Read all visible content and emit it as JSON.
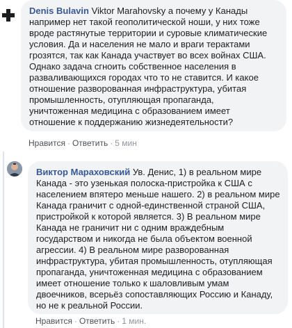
{
  "comment1": {
    "author": "Denis Bulavin",
    "mention": "Viktor Marahovsky",
    "lines": [
      "а почему у Канады",
      "например нет такой геополитической ноши, у них тоже",
      "вроде растянутые территории и суровые климатические",
      "условия. Да и населения не мало и враги терактами",
      "грозятся, так как Канада участвует во всех войнах США.",
      "Однако задача сгноить собственное населения в",
      "разваливающихся городах что то не ставится. И какое",
      "отношение разворованная инфраструктура, убитая",
      "промышленность, отупляющая пропаганда,",
      "уничтоженная медицина с образованием имеет",
      "отношение к поддержанию жизнедеятельности?"
    ],
    "like_label": "Нравится",
    "reply_label": "Ответить",
    "time": "5 мин",
    "separator": "·"
  },
  "comment2": {
    "author": "Виктор Мараховский",
    "mention": "Ув. Денис,",
    "first_line_rest": "1) в реальном мире",
    "lines": [
      "Канада - это узенькая полоска-пристройка к США с",
      "населением впятеро меньше нашего. 2) в реальном мире",
      "Канада граничит с одной-единственной страной США,",
      "пристройкой к которой является. 3) В реальном мире",
      "Канада не граничит ни с одним враждебным",
      "государством и никогда не была объектом военной",
      "агрессии. 4) В реальном мире разворованная",
      "инфраструктура, убитая промышленность, отупляющая",
      "пропаганда, уничтоженная медицина с образованием",
      "имеет отношение только к шаловливым умам",
      "двоечников, всерьёз сопоставляющих Россию и Канаду,",
      "но не к реальной России."
    ],
    "like_label": "Нравится",
    "reply_label": "Ответить",
    "time": "1 мин.",
    "separator": "·"
  },
  "icons": {
    "cross": "cross-icon",
    "avatar": "avatar"
  }
}
